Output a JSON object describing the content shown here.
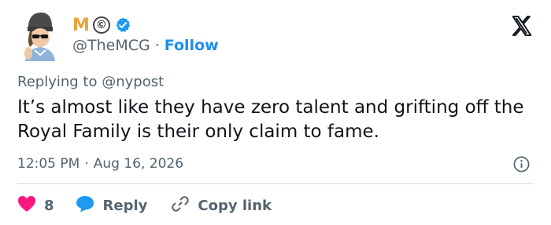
{
  "author": {
    "display_name_text": "M",
    "display_name_symbol": "©",
    "handle": "@TheMCG",
    "follow_label": "Follow",
    "verified": true
  },
  "separator": "·",
  "replying": {
    "prefix": "Replying to",
    "mention": "@nypost"
  },
  "tweet": {
    "text": "It’s almost like they have zero talent and grifting off the Royal Family is their only claim to fame."
  },
  "meta": {
    "time": "12:05 PM",
    "date": "Aug 16, 2026"
  },
  "actions": {
    "like_count": "8",
    "reply_label": "Reply",
    "copy_label": "Copy link"
  },
  "colors": {
    "like": "#f91880",
    "reply": "#1d9bf0",
    "follow": "#1d8ff0",
    "name": "#e9a23b",
    "muted": "#536471"
  },
  "icons": [
    "x-logo-icon",
    "verified-badge-icon",
    "info-icon",
    "heart-icon",
    "reply-bubble-icon",
    "link-icon"
  ]
}
